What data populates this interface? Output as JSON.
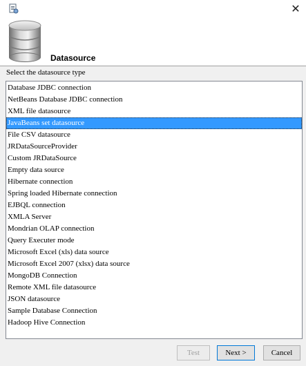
{
  "window": {
    "close_glyph": "✕"
  },
  "banner": {
    "title": "Datasource",
    "icon": "database-icon"
  },
  "prompt": "Select the datasource type",
  "datasource_types": [
    "Database JDBC connection",
    "NetBeans Database JDBC connection",
    "XML file datasource",
    "JavaBeans set datasource",
    "File CSV datasource",
    "JRDataSourceProvider",
    "Custom JRDataSource",
    "Empty data source",
    "Hibernate connection",
    "Spring loaded Hibernate connection",
    "EJBQL connection",
    "XMLA Server",
    "Mondrian OLAP connection",
    "Query Executer mode",
    "Microsoft Excel (xls) data source",
    "Microsoft Excel 2007 (xlsx) data source",
    "MongoDB Connection",
    "Remote XML file datasource",
    "JSON datasource",
    "Sample Database Connection",
    "Hadoop Hive Connection"
  ],
  "selected_index": 3,
  "buttons": {
    "test": "Test",
    "next": "Next >",
    "cancel": "Cancel"
  },
  "colors": {
    "selection": "#3399ff",
    "default_button_border": "#0078d7"
  }
}
